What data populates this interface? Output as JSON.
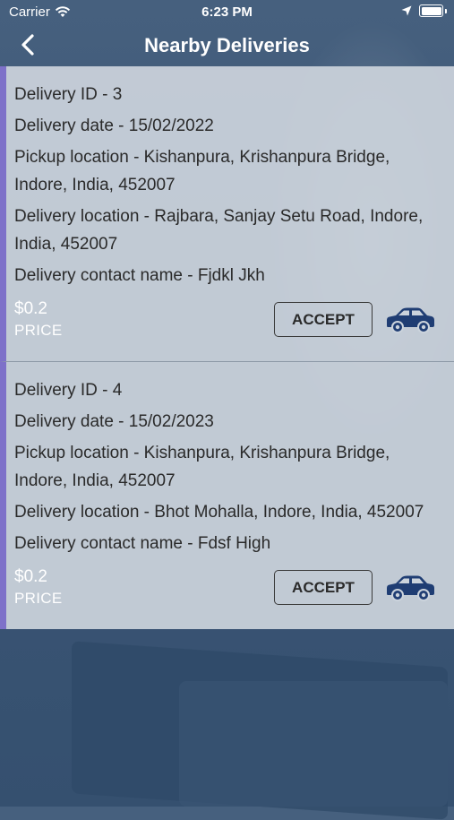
{
  "status_bar": {
    "carrier": "Carrier",
    "time": "6:23 PM"
  },
  "nav": {
    "title": "Nearby Deliveries"
  },
  "deliveries": [
    {
      "id_line": "Delivery ID - 3",
      "date_line": "Delivery date - 15/02/2022",
      "pickup_line": "Pickup location - Kishanpura, Krishanpura Bridge, Indore, India, 452007",
      "delivery_line": "Delivery location - Rajbara, Sanjay Setu Road, Indore, India, 452007",
      "contact_line": "Delivery contact name - Fjdkl Jkh",
      "price": "$0.2",
      "price_label": "PRICE",
      "accept_label": "ACCEPT"
    },
    {
      "id_line": "Delivery ID - 4",
      "date_line": "Delivery date - 15/02/2023",
      "pickup_line": "Pickup location - Kishanpura, Krishanpura Bridge, Indore, India, 452007",
      "delivery_line": "Delivery location - Bhot Mohalla, Indore, India, 452007",
      "contact_line": "Delivery contact name - Fdsf High",
      "price": "$0.2",
      "price_label": "PRICE",
      "accept_label": "ACCEPT"
    }
  ],
  "colors": {
    "accent_border": "#7e71c9",
    "car_icon": "#1f3d73"
  },
  "icons": {
    "back": "chevron-left-icon",
    "vehicle": "car-icon"
  }
}
